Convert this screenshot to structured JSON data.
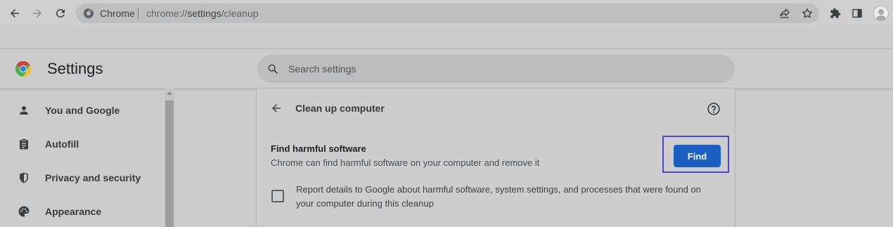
{
  "browser": {
    "site_chip": "Chrome",
    "url_scheme": "chrome://",
    "url_host": "settings",
    "url_path": "/cleanup",
    "icons": [
      "back-arrow-icon",
      "forward-arrow-icon",
      "reload-icon",
      "site-info-icon",
      "share-icon",
      "star-icon",
      "extensions-puzzle-icon",
      "side-panel-icon",
      "profile-avatar-icon"
    ]
  },
  "header": {
    "title": "Settings",
    "search_placeholder": "Search settings"
  },
  "sidebar": {
    "items": [
      {
        "label": "You and Google",
        "icon": "person-icon"
      },
      {
        "label": "Autofill",
        "icon": "clipboard-icon"
      },
      {
        "label": "Privacy and security",
        "icon": "shield-icon"
      },
      {
        "label": "Appearance",
        "icon": "palette-icon"
      }
    ]
  },
  "card": {
    "title": "Clean up computer",
    "find_title": "Find harmful software",
    "find_desc": "Chrome can find harmful software on your computer and remove it",
    "find_button": "Find",
    "report_checked": false,
    "report_text": "Report details to Google about harmful software, system settings, and processes that were found on your computer during this cleanup"
  },
  "colors": {
    "accent_button": "#1c5fc2",
    "highlight_border": "#4b49c9",
    "background": "#cccccc"
  }
}
